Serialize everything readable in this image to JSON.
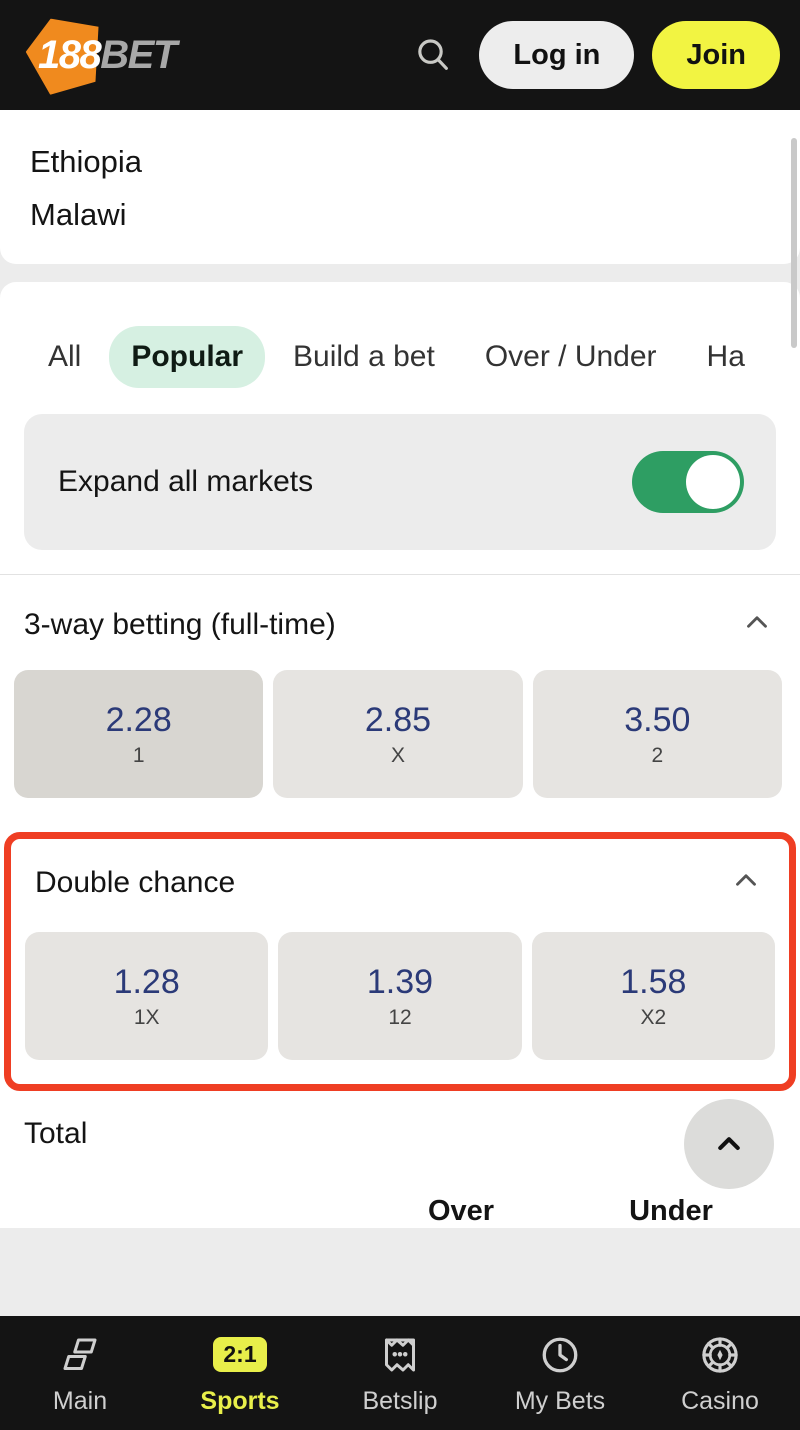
{
  "header": {
    "logo_primary": "188",
    "logo_secondary": "BET",
    "search_icon": "search-icon",
    "login_label": "Log in",
    "join_label": "Join"
  },
  "event": {
    "home_team": "Ethiopia",
    "away_team": "Malawi"
  },
  "tabs": [
    {
      "label": "All",
      "active": false
    },
    {
      "label": "Popular",
      "active": true
    },
    {
      "label": "Build a bet",
      "active": false
    },
    {
      "label": "Over / Under",
      "active": false
    },
    {
      "label": "Ha",
      "active": false
    }
  ],
  "expand": {
    "label": "Expand all markets",
    "toggle_on": true,
    "toggle_color": "#2e9e63"
  },
  "markets": [
    {
      "title": "3-way betting (full-time)",
      "collapse_icon": "chevron-up-icon",
      "highlighted": false,
      "selections": [
        {
          "odds": "2.28",
          "label": "1",
          "pressed": true
        },
        {
          "odds": "2.85",
          "label": "X",
          "pressed": false
        },
        {
          "odds": "3.50",
          "label": "2",
          "pressed": false
        }
      ]
    },
    {
      "title": "Double chance",
      "collapse_icon": "chevron-up-icon",
      "highlighted": true,
      "highlight_color": "#ef3e23",
      "selections": [
        {
          "odds": "1.28",
          "label": "1X",
          "pressed": false
        },
        {
          "odds": "1.39",
          "label": "12",
          "pressed": false
        },
        {
          "odds": "1.58",
          "label": "X2",
          "pressed": false
        }
      ]
    }
  ],
  "total": {
    "title": "Total",
    "over_label": "Over",
    "under_label": "Under",
    "scroll_top_icon": "chevron-up-icon"
  },
  "bottom_nav": [
    {
      "label": "Main",
      "icon": "panels-icon",
      "active": false
    },
    {
      "label": "Sports",
      "icon": "score-2-1-badge-icon",
      "badge": "2:1",
      "active": true
    },
    {
      "label": "Betslip",
      "icon": "ticket-icon",
      "active": false
    },
    {
      "label": "My Bets",
      "icon": "clock-icon",
      "active": false
    },
    {
      "label": "Casino",
      "icon": "casino-chip-icon",
      "active": false
    }
  ],
  "colors": {
    "brand_orange": "#F08A1E",
    "accent_yellow": "#f2f442",
    "odds_blue": "#2b3a78",
    "toggle_green": "#2e9e63",
    "tab_active_bg": "#d6f0e2",
    "highlight_red": "#ef3e23"
  }
}
